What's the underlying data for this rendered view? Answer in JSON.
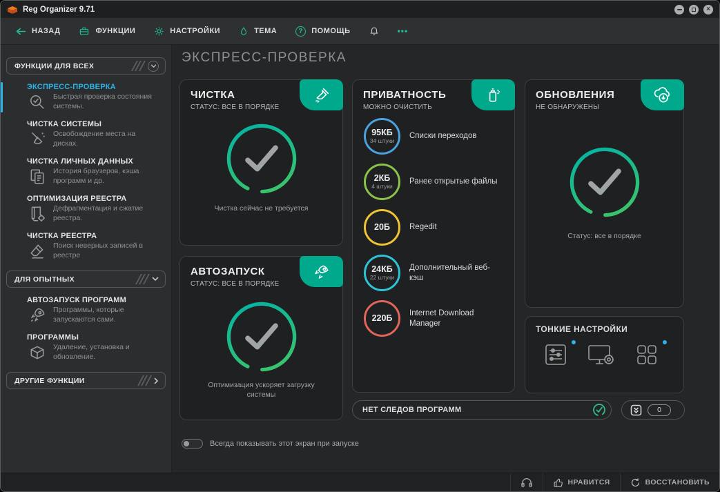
{
  "window": {
    "title": "Reg Organizer 9.71"
  },
  "glyphs": {
    "close": "×",
    "question": "?",
    "more": "•••"
  },
  "toolbar": {
    "back": "НАЗАД",
    "functions": "ФУНКЦИИ",
    "settings": "НАСТРОЙКИ",
    "theme": "ТЕМА",
    "help": "ПОМОЩЬ"
  },
  "sidebar": {
    "group_all": "ФУНКЦИИ ДЛЯ ВСЕХ",
    "group_advanced": "ДЛЯ ОПЫТНЫХ",
    "group_other": "ДРУГИЕ ФУНКЦИИ",
    "items": [
      {
        "title": "ЭКСПРЕСС-ПРОВЕРКА",
        "desc": "Быстрая проверка состояния системы."
      },
      {
        "title": "ЧИСТКА СИСТЕМЫ",
        "desc": "Освобождение места на дисках."
      },
      {
        "title": "ЧИСТКА ЛИЧНЫХ ДАННЫХ",
        "desc": "История браузеров, кэша программ и др."
      },
      {
        "title": "ОПТИМИЗАЦИЯ РЕЕСТРА",
        "desc": "Дефрагментация и сжатие реестра."
      },
      {
        "title": "ЧИСТКА РЕЕСТРА",
        "desc": "Поиск неверных записей в реестре"
      }
    ],
    "advanced_items": [
      {
        "title": "АВТОЗАПУСК ПРОГРАММ",
        "desc": "Программы, которые запускаются сами."
      },
      {
        "title": "ПРОГРАММЫ",
        "desc": "Удаление, установка и обновление."
      }
    ]
  },
  "main": {
    "title": "ЭКСПРЕСС-ПРОВЕРКА",
    "cleanup": {
      "title": "ЧИСТКА",
      "status": "СТАТУС: ВСЕ В ПОРЯДКЕ",
      "note": "Чистка сейчас не требуется"
    },
    "autorun": {
      "title": "АВТОЗАПУСК",
      "status": "СТАТУС: ВСЕ В ПОРЯДКЕ",
      "note": "Оптимизация ускоряет загрузку системы"
    },
    "privacy": {
      "title": "ПРИВАТНОСТЬ",
      "status": "МОЖНО ОЧИСТИТЬ",
      "items": [
        {
          "size": "95КБ",
          "count": "34 штуки",
          "label": "Списки переходов",
          "color": "#4aa3df"
        },
        {
          "size": "2КБ",
          "count": "4 штуки",
          "label": "Ранее открытые файлы",
          "color": "#8bc24a"
        },
        {
          "size": "20Б",
          "count": "",
          "label": "Regedit",
          "color": "#f0c330"
        },
        {
          "size": "24КБ",
          "count": "22 штуки",
          "label": "Дополнительный веб-кэш",
          "color": "#2ec4d6"
        },
        {
          "size": "220Б",
          "count": "",
          "label": "Internet Download Manager",
          "color": "#e2655c"
        }
      ]
    },
    "updates": {
      "title": "ОБНОВЛЕНИЯ",
      "status": "НЕ ОБНАРУЖЕНЫ",
      "note": "Статус: все в порядке"
    },
    "tweaks": {
      "title": "ТОНКИЕ НАСТРОЙКИ"
    },
    "traces": "НЕТ СЛЕДОВ ПРОГРАММ",
    "counter": "0",
    "toggle_label": "Всегда показывать этот экран при запуске"
  },
  "statusbar": {
    "like": "НРАВИТСЯ",
    "restore": "ВОССТАНОВИТЬ"
  },
  "colors": {
    "accent_teal": "#00a98c",
    "selected_cyan": "#2bb3e8",
    "ok_green": "#3ec06a",
    "toolbar_icon_green": "#1fbd97"
  }
}
